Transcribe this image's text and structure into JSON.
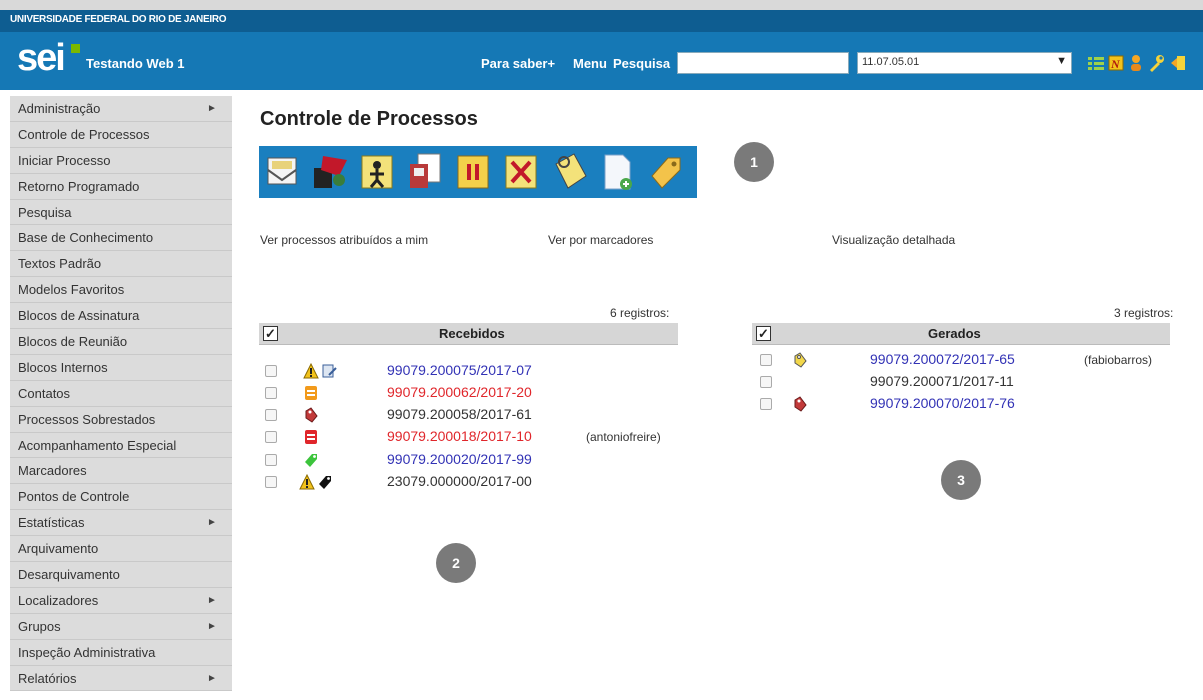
{
  "header": {
    "university": "UNIVERSIDADE FEDERAL DO RIO DE JANEIRO",
    "logo": "sei",
    "unit_name": "Testando Web 1",
    "links": [
      "Para saber+",
      "Menu",
      "Pesquisa"
    ],
    "search_value": "",
    "unit_select": "11.07.05.01",
    "icons": [
      "list-icon",
      "notes-icon",
      "user-icon",
      "wrench-icon",
      "exit-icon"
    ],
    "bar_color": "#1578b5"
  },
  "sidebar": {
    "items": [
      {
        "label": "Administração",
        "submenu": true
      },
      {
        "label": "Controle de Processos",
        "submenu": false
      },
      {
        "label": "Iniciar Processo",
        "submenu": false
      },
      {
        "label": "Retorno Programado",
        "submenu": false
      },
      {
        "label": "Pesquisa",
        "submenu": false
      },
      {
        "label": "Base de Conhecimento",
        "submenu": false
      },
      {
        "label": "Textos Padrão",
        "submenu": false
      },
      {
        "label": "Modelos Favoritos",
        "submenu": false
      },
      {
        "label": "Blocos de Assinatura",
        "submenu": false
      },
      {
        "label": "Blocos de Reunião",
        "submenu": false
      },
      {
        "label": "Blocos Internos",
        "submenu": false
      },
      {
        "label": "Contatos",
        "submenu": false
      },
      {
        "label": "Processos Sobrestados",
        "submenu": false
      },
      {
        "label": "Acompanhamento Especial",
        "submenu": false
      },
      {
        "label": "Marcadores",
        "submenu": false
      },
      {
        "label": "Pontos de Controle",
        "submenu": false
      },
      {
        "label": "Estatísticas",
        "submenu": true
      },
      {
        "label": "Arquivamento",
        "submenu": false
      },
      {
        "label": "Desarquivamento",
        "submenu": false
      },
      {
        "label": "Localizadores",
        "submenu": true
      },
      {
        "label": "Grupos",
        "submenu": true
      },
      {
        "label": "Inspeção Administrativa",
        "submenu": false
      },
      {
        "label": "Relatórios",
        "submenu": true
      }
    ],
    "submenu_arrow": "►"
  },
  "main": {
    "title": "Controle de Processos",
    "toolbar_icons": [
      "send-process-icon",
      "attribute-process-icon",
      "assign-user-icon",
      "duplicate-icon",
      "suspend-icon",
      "cancel-icon",
      "annotation-icon",
      "new-document-icon",
      "tag-icon"
    ],
    "badges": [
      "1",
      "2",
      "3"
    ],
    "view_links": [
      "Ver processos atribuídos a mim",
      "Ver por marcadores",
      "Visualização detalhada"
    ],
    "received": {
      "count": "6 registros:",
      "header": "Recebidos",
      "rows": [
        {
          "process": "99079.200075/2017-07",
          "color": "#3232b5",
          "note": "",
          "icons": [
            "warning-icon",
            "edit-document-icon"
          ]
        },
        {
          "process": "99079.200062/2017-20",
          "color": "#e0262b",
          "note": "",
          "icons": [
            "orange-document-icon"
          ]
        },
        {
          "process": "99079.200058/2017-61",
          "color": "#333333",
          "note": "",
          "icons": [
            "red-tag-icon"
          ]
        },
        {
          "process": "99079.200018/2017-10",
          "color": "#e0262b",
          "note": "(antoniofreire)",
          "icons": [
            "red-document-icon"
          ]
        },
        {
          "process": "99079.200020/2017-99",
          "color": "#3232b5",
          "note": "",
          "icons": [
            "green-tag-icon"
          ]
        },
        {
          "process": "23079.000000/2017-00",
          "color": "#333333",
          "note": "",
          "icons": [
            "warning-icon",
            "black-tag-icon"
          ]
        }
      ]
    },
    "generated": {
      "count": "3 registros:",
      "header": "Gerados",
      "rows": [
        {
          "process": "99079.200072/2017-65",
          "color": "#3232b5",
          "note": "(fabiobarros)",
          "icons": [
            "yellow-tag-icon"
          ]
        },
        {
          "process": "99079.200071/2017-11",
          "color": "#333333",
          "note": "",
          "icons": []
        },
        {
          "process": "99079.200070/2017-76",
          "color": "#3232b5",
          "note": "",
          "icons": [
            "red-tag-icon"
          ]
        }
      ]
    }
  }
}
